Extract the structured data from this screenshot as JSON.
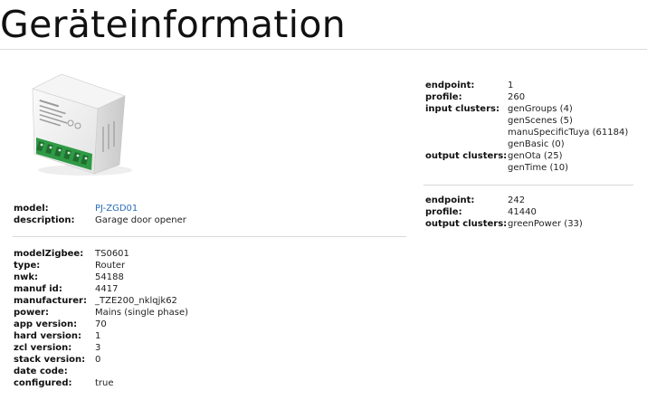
{
  "page": {
    "title": "Geräteinformation"
  },
  "device_basic": [
    {
      "label": "model:",
      "value": "PJ-ZGD01",
      "link": true
    },
    {
      "label": "description:",
      "value": "Garage door opener"
    }
  ],
  "device_details": [
    {
      "label": "modelZigbee:",
      "value": "TS0601"
    },
    {
      "label": "type:",
      "value": "Router"
    },
    {
      "label": "nwk:",
      "value": "54188"
    },
    {
      "label": "manuf id:",
      "value": "4417"
    },
    {
      "label": "manufacturer:",
      "value": "_TZE200_nklqjk62"
    },
    {
      "label": "power:",
      "value": "Mains (single phase)"
    },
    {
      "label": "app version:",
      "value": "70"
    },
    {
      "label": "hard version:",
      "value": "1"
    },
    {
      "label": "zcl version:",
      "value": "3"
    },
    {
      "label": "stack version:",
      "value": "0"
    },
    {
      "label": "date code:",
      "value": ""
    },
    {
      "label": "configured:",
      "value": "true"
    }
  ],
  "endpoint_1": [
    {
      "label": "endpoint:",
      "value": "1"
    },
    {
      "label": "profile:",
      "value": "260"
    },
    {
      "label": "input clusters:",
      "value": "genGroups (4)"
    },
    {
      "label": "",
      "value": "genScenes (5)"
    },
    {
      "label": "",
      "value": "manuSpecificTuya (61184)"
    },
    {
      "label": "",
      "value": "genBasic (0)"
    },
    {
      "label": "output clusters:",
      "value": "genOta (25)"
    },
    {
      "label": "",
      "value": "genTime (10)"
    }
  ],
  "endpoint_2": [
    {
      "label": "endpoint:",
      "value": "242"
    },
    {
      "label": "profile:",
      "value": "41440"
    },
    {
      "label": "output clusters:",
      "value": "greenPower (33)"
    }
  ]
}
